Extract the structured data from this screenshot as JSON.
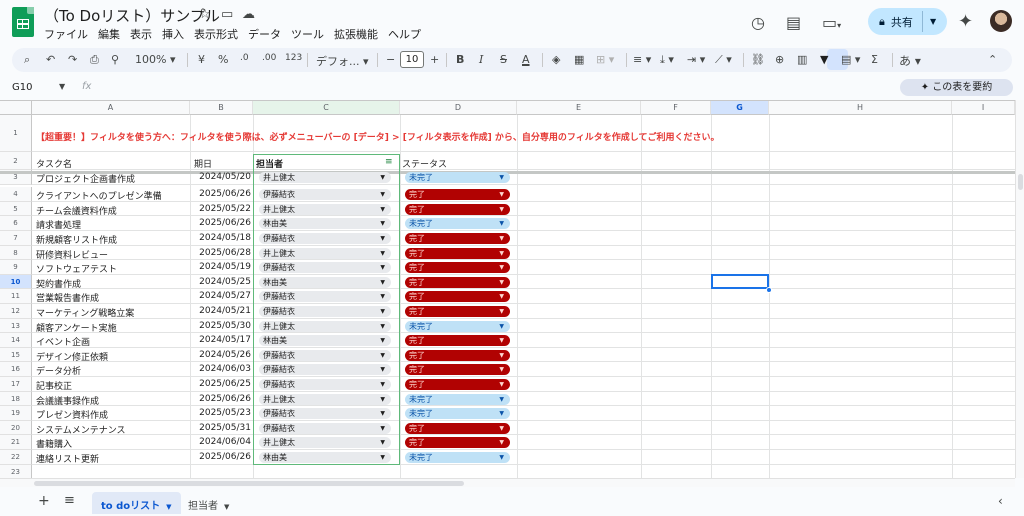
{
  "title": "（To Doリスト）サンプル",
  "title_icons": [
    "star-icon",
    "move-folder-icon",
    "cloud-status-icon"
  ],
  "menu": [
    "ファイル",
    "編集",
    "表示",
    "挿入",
    "表示形式",
    "データ",
    "ツール",
    "拡張機能",
    "ヘルプ"
  ],
  "share_label": "共有",
  "toolbar": {
    "zoom": "100%",
    "currency": "¥",
    "percent": "%",
    "dec_decrease": ".0",
    "dec_increase": ".00",
    "number_format": "123",
    "font": "デフォ...",
    "font_size": "10",
    "input_tool": "あ"
  },
  "namebox": "G10",
  "fx": "fx",
  "summary_button": "この表を要約",
  "columns": [
    "A",
    "B",
    "C",
    "D",
    "E",
    "F",
    "G",
    "H",
    "I"
  ],
  "selected_column": "G",
  "selected_row": "10",
  "row_numbers": [
    "1",
    "2",
    "3",
    "4",
    "5",
    "6",
    "7",
    "8",
    "9",
    "10",
    "11",
    "12",
    "13",
    "14",
    "15",
    "16",
    "17",
    "18",
    "19",
    "20",
    "21",
    "22",
    "23"
  ],
  "banner": "【超重要！】フィルタを使う方へ：フィルタを使う際は、必ずメニューバーの [データ] > [フィルタ表示を作成] から、自分専用のフィルタを作成してご利用ください。",
  "headers": {
    "task": "タスク名",
    "date": "期日",
    "assignee": "担当者",
    "status": "ステータス"
  },
  "tasks": [
    {
      "task": "プロジェクト企画書作成",
      "date": "2024/05/20",
      "assignee": "井上健太",
      "status": "未完了"
    },
    {
      "task": "クライアントへのプレゼン準備",
      "date": "2025/06/26",
      "assignee": "伊藤結衣",
      "status": "完了"
    },
    {
      "task": "チーム会議資料作成",
      "date": "2025/05/22",
      "assignee": "井上健太",
      "status": "完了"
    },
    {
      "task": "請求書処理",
      "date": "2025/06/26",
      "assignee": "林由美",
      "status": "未完了"
    },
    {
      "task": "新規顧客リスト作成",
      "date": "2024/05/18",
      "assignee": "伊藤結衣",
      "status": "完了"
    },
    {
      "task": "研修資料レビュー",
      "date": "2025/06/28",
      "assignee": "井上健太",
      "status": "完了"
    },
    {
      "task": "ソフトウェアテスト",
      "date": "2024/05/19",
      "assignee": "伊藤結衣",
      "status": "完了"
    },
    {
      "task": "契約書作成",
      "date": "2024/05/25",
      "assignee": "林由美",
      "status": "完了"
    },
    {
      "task": "営業報告書作成",
      "date": "2024/05/27",
      "assignee": "伊藤結衣",
      "status": "完了"
    },
    {
      "task": "マーケティング戦略立案",
      "date": "2024/05/21",
      "assignee": "伊藤結衣",
      "status": "完了"
    },
    {
      "task": "顧客アンケート実施",
      "date": "2025/05/30",
      "assignee": "井上健太",
      "status": "未完了"
    },
    {
      "task": "イベント企画",
      "date": "2024/05/17",
      "assignee": "林由美",
      "status": "完了"
    },
    {
      "task": "デザイン修正依頼",
      "date": "2024/05/26",
      "assignee": "伊藤結衣",
      "status": "完了"
    },
    {
      "task": "データ分析",
      "date": "2024/06/03",
      "assignee": "伊藤結衣",
      "status": "完了"
    },
    {
      "task": "記事校正",
      "date": "2025/06/25",
      "assignee": "伊藤結衣",
      "status": "完了"
    },
    {
      "task": "会議議事録作成",
      "date": "2025/06/26",
      "assignee": "井上健太",
      "status": "未完了"
    },
    {
      "task": "プレゼン資料作成",
      "date": "2025/05/23",
      "assignee": "伊藤結衣",
      "status": "未完了"
    },
    {
      "task": "システムメンテナンス",
      "date": "2025/05/31",
      "assignee": "伊藤結衣",
      "status": "完了"
    },
    {
      "task": "書籍購入",
      "date": "2024/06/04",
      "assignee": "井上健太",
      "status": "完了"
    },
    {
      "task": "連絡リスト更新",
      "date": "2025/06/26",
      "assignee": "林由美",
      "status": "未完了"
    }
  ],
  "status_colors": {
    "done_bg": "#b10202",
    "todo_bg": "#bfe1f6"
  },
  "sheet_tabs": [
    "to doリスト",
    "担当者"
  ],
  "active_tab": "to doリスト"
}
